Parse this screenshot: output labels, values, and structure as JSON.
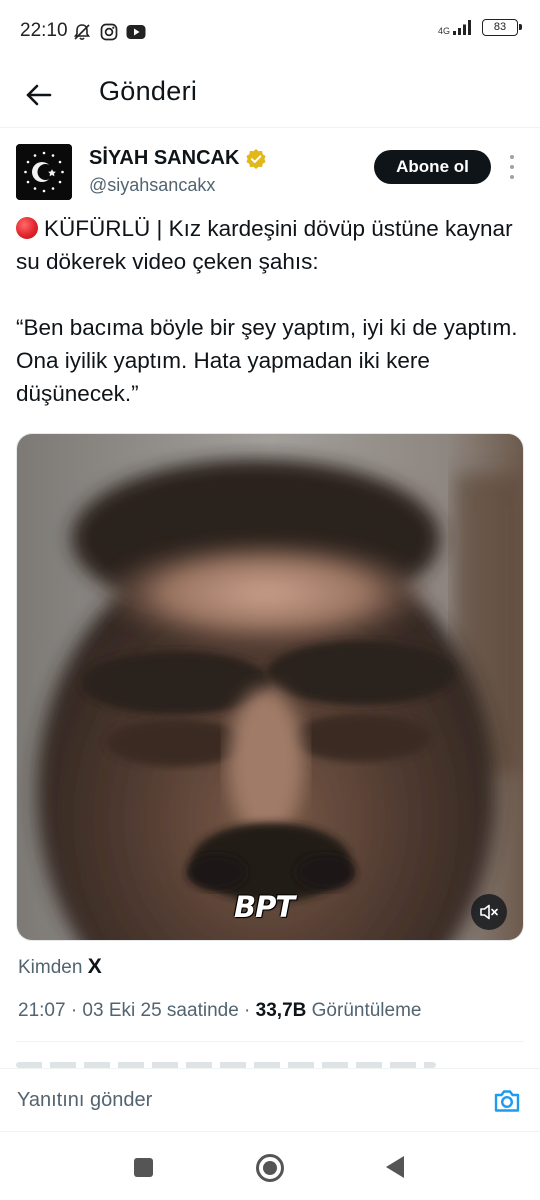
{
  "status_bar": {
    "time": "22:10",
    "network": "4G",
    "battery": "83"
  },
  "header": {
    "title": "Gönderi"
  },
  "tweet": {
    "author_name": "SİYAH SANCAK",
    "author_handle": "@siyahsancakx",
    "follow_label": "Abone ol",
    "text_line1": "KÜFÜRLÜ | Kız kardeşini dövüp üstüne kaynar su dökerek video çeken şahıs:",
    "quote": "“Ben bacıma böyle bir şey yaptım, iyi ki de yaptım. Ona iyilik yaptım. Hata yapmadan iki kere düşünecek.”",
    "watermark": "BPT",
    "source_label": "Kimden",
    "source_app": "X",
    "timestamp": "21:07 · 03 Eki 25 saatinde ·",
    "view_count": "33,7B",
    "views_label": "Görüntüleme"
  },
  "reply": {
    "placeholder": "Yanıtını gönder"
  },
  "colors": {
    "text": "#0f1419",
    "secondary": "#536471",
    "accent": "#1d9bf0",
    "verified_gold": "#e2b719",
    "red_dot": "#e3242b"
  },
  "icons": [
    "back-arrow-icon",
    "mute-notification-icon",
    "instagram-icon",
    "youtube-icon",
    "signal-icon",
    "battery-icon",
    "verified-badge-icon",
    "more-options-icon",
    "mute-icon",
    "camera-icon"
  ]
}
